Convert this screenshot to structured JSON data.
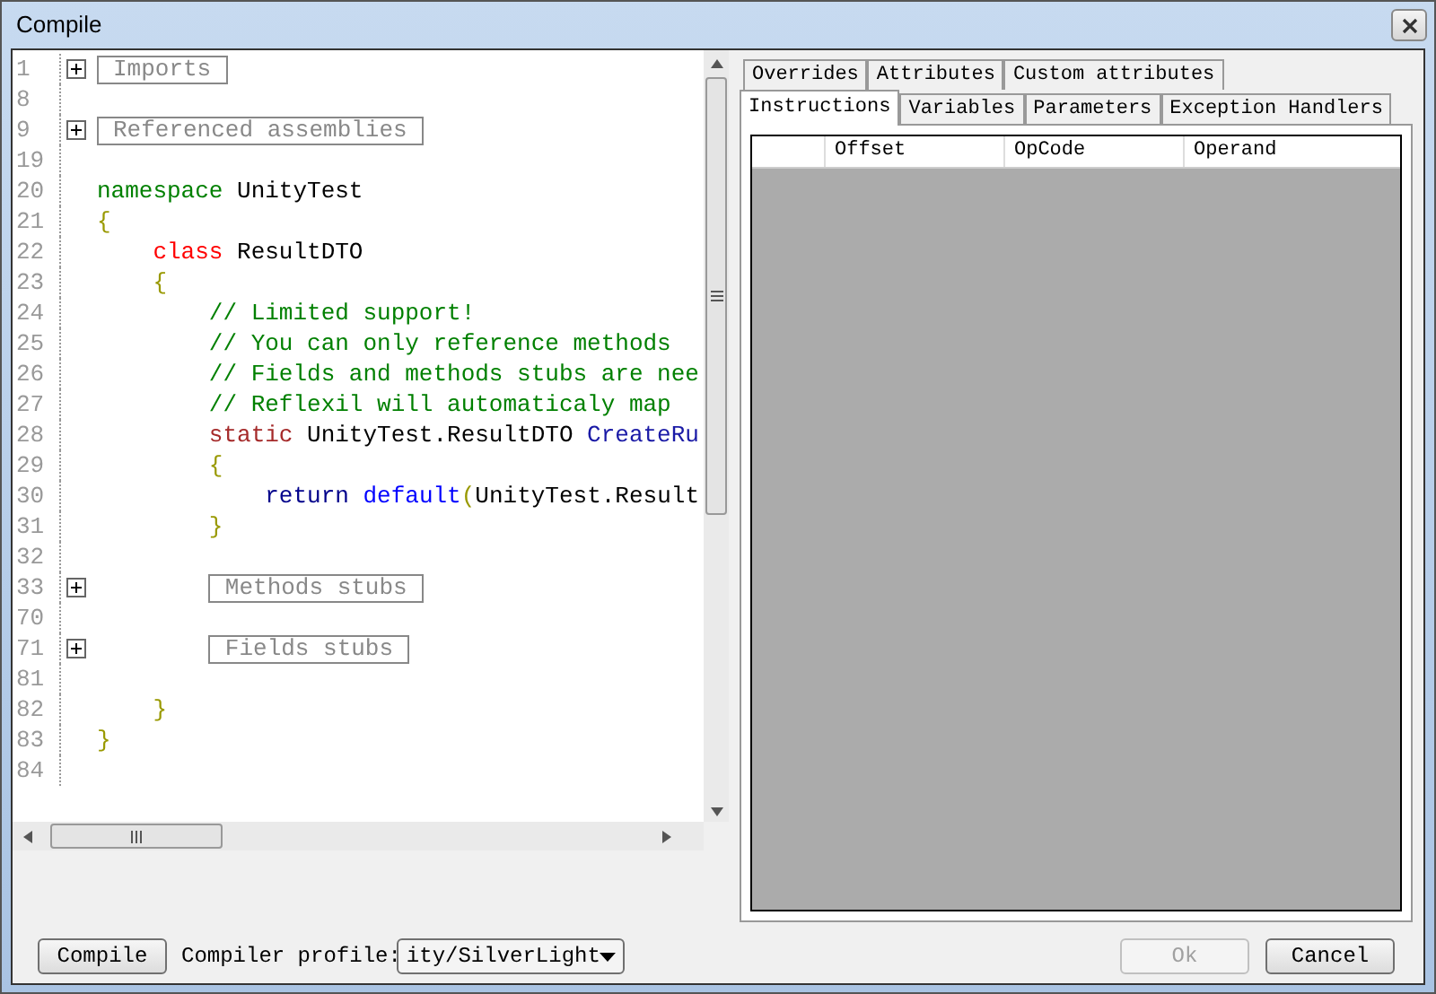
{
  "window": {
    "title": "Compile"
  },
  "editor": {
    "lines": [
      {
        "number": "1",
        "kind": "fold",
        "label": "Imports",
        "expanded": false
      },
      {
        "number": "8",
        "kind": "code"
      },
      {
        "number": "9",
        "kind": "fold",
        "label": "Referenced assemblies",
        "expanded": false
      },
      {
        "number": "19",
        "kind": "code"
      },
      {
        "number": "20",
        "kind": "code",
        "tokens": [
          {
            "kind": "namespace",
            "text": "namespace"
          },
          {
            "kind": "plain",
            "text": " UnityTest"
          }
        ]
      },
      {
        "number": "21",
        "kind": "code",
        "tokens": [
          {
            "kind": "brace",
            "text": "{"
          }
        ]
      },
      {
        "number": "22",
        "kind": "code",
        "tokens": [
          {
            "kind": "class",
            "text": "    class"
          },
          {
            "kind": "plain",
            "text": " ResultDTO"
          }
        ]
      },
      {
        "number": "23",
        "kind": "code",
        "tokens": [
          {
            "kind": "brace",
            "text": "    {"
          }
        ]
      },
      {
        "number": "24",
        "kind": "code",
        "tokens": [
          {
            "kind": "comment",
            "text": "        // Limited support!"
          }
        ]
      },
      {
        "number": "25",
        "kind": "code",
        "tokens": [
          {
            "kind": "comment",
            "text": "        // You can only reference methods"
          }
        ]
      },
      {
        "number": "26",
        "kind": "code",
        "tokens": [
          {
            "kind": "comment",
            "text": "        // Fields and methods stubs are nee"
          }
        ]
      },
      {
        "number": "27",
        "kind": "code",
        "tokens": [
          {
            "kind": "comment",
            "text": "        // Reflexil will automaticaly map"
          }
        ]
      },
      {
        "number": "28",
        "kind": "code",
        "tokens": [
          {
            "kind": "modifier",
            "text": "        static"
          },
          {
            "kind": "plain",
            "text": " UnityTest.ResultDTO "
          },
          {
            "kind": "method",
            "text": "CreateRu"
          }
        ]
      },
      {
        "number": "29",
        "kind": "code",
        "tokens": [
          {
            "kind": "brace",
            "text": "        {"
          }
        ]
      },
      {
        "number": "30",
        "kind": "code",
        "tokens": [
          {
            "kind": "flow",
            "text": "            return"
          },
          {
            "kind": "default",
            "text": " default"
          },
          {
            "kind": "brace",
            "text": "("
          },
          {
            "kind": "plain",
            "text": "UnityTest.Result"
          }
        ]
      },
      {
        "number": "31",
        "kind": "code",
        "tokens": [
          {
            "kind": "brace",
            "text": "        }"
          }
        ]
      },
      {
        "number": "32",
        "kind": "code"
      },
      {
        "number": "33",
        "kind": "fold",
        "label": "        Methods stubs",
        "expanded": false
      },
      {
        "number": "70",
        "kind": "code"
      },
      {
        "number": "71",
        "kind": "fold",
        "label": "        Fields stubs",
        "expanded": false
      },
      {
        "number": "81",
        "kind": "code"
      },
      {
        "number": "82",
        "kind": "code",
        "tokens": [
          {
            "kind": "brace",
            "text": "    }"
          }
        ]
      },
      {
        "number": "83",
        "kind": "code",
        "tokens": [
          {
            "kind": "brace",
            "text": "}"
          }
        ]
      },
      {
        "number": "84",
        "kind": "code"
      }
    ]
  },
  "tab_rows": [
    {
      "tabs": [
        {
          "label": "Overrides",
          "selected": false
        },
        {
          "label": "Attributes",
          "selected": false
        },
        {
          "label": "Custom attributes",
          "selected": false
        }
      ]
    },
    {
      "tabs": [
        {
          "label": "Instructions",
          "selected": true
        },
        {
          "label": "Variables",
          "selected": false
        },
        {
          "label": "Parameters",
          "selected": false
        },
        {
          "label": "Exception Handlers",
          "selected": false
        }
      ]
    }
  ],
  "table": {
    "columns": [
      "Offset",
      "OpCode",
      "Operand"
    ]
  },
  "footer": {
    "compile_button": "Compile",
    "profile_label": "Compiler profile:",
    "profile_value": "ity/SilverLight",
    "ok_button": {
      "label": "Ok",
      "disabled": true
    },
    "cancel_button": {
      "label": "Cancel",
      "disabled": false
    }
  }
}
